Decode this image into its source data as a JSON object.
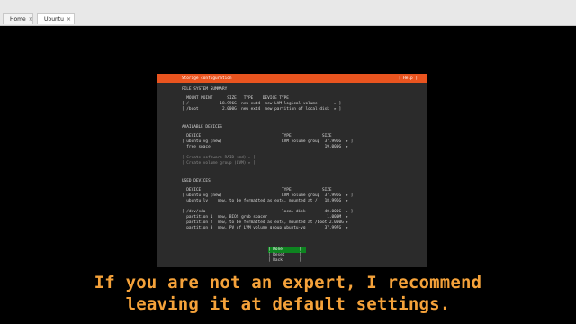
{
  "tabs": [
    {
      "label": "Home"
    },
    {
      "label": "Ubuntu"
    }
  ],
  "header": {
    "title": "Storage configuration",
    "help": "[ Help ]"
  },
  "fs_summary": {
    "heading": "FILE SYSTEM SUMMARY",
    "columns": "  MOUNT POINT      SIZE   TYPE    DEVICE TYPE",
    "rows": [
      "[ /             18.996G  new ext4  new LVM logical volume       ▸ ]",
      "[ /boot          2.000G  new ext4  new partition of local disk  ▸ ]"
    ]
  },
  "available": {
    "heading": "AVAILABLE DEVICES",
    "columns": "  DEVICE                                  TYPE             SIZE",
    "rows": [
      "[ ubuntu-vg (new)                         LVM volume group  37.996G  ▸ ]",
      "  free space                                                19.000G  ▸"
    ],
    "actions": [
      "[ Create software RAID (md) ▸ ]",
      "[ Create volume group (LVM) ▸ ]"
    ]
  },
  "used": {
    "heading": "USED DEVICES",
    "columns": "  DEVICE                                  TYPE             SIZE",
    "rows": [
      "[ ubuntu-vg (new)                         LVM volume group  37.996G  ▸ ]",
      "  ubuntu-lv    new, to be formatted as ext4, mounted at /   18.996G  ▸",
      "",
      "[ /dev/sda                                local disk        40.000G  ▸ ]",
      "  partition 1  new, BIOS grub spacer                         1.000M  ▸",
      "  partition 2  new, to be formatted as ext4, mounted at /boot 2.000G ▸",
      "  partition 3  new, PV of LVM volume group ubuntu-vg        37.997G  ▸"
    ]
  },
  "buttons": [
    "[ Done       ]",
    "[ Reset      ]",
    "[ Back       ]"
  ],
  "caption": {
    "line1": "If you are not an expert, I recommend",
    "line2": "leaving it at default settings."
  }
}
